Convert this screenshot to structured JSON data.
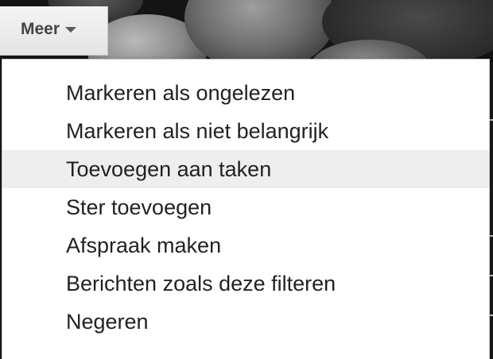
{
  "toolbar": {
    "more_label": "Meer"
  },
  "menu": {
    "items": [
      {
        "label": "Markeren als ongelezen"
      },
      {
        "label": "Markeren als niet belangrijk"
      },
      {
        "label": "Toevoegen aan taken"
      },
      {
        "label": "Ster toevoegen"
      },
      {
        "label": "Afspraak maken"
      },
      {
        "label": "Berichten zoals deze filteren"
      },
      {
        "label": "Negeren"
      }
    ],
    "hovered_index": 2
  },
  "colors": {
    "menu_background": "#ffffff",
    "hover_background": "#eeeeee",
    "text": "#222222",
    "button_text": "#444444"
  },
  "icons": {
    "more_caret": "chevron-down-icon"
  }
}
